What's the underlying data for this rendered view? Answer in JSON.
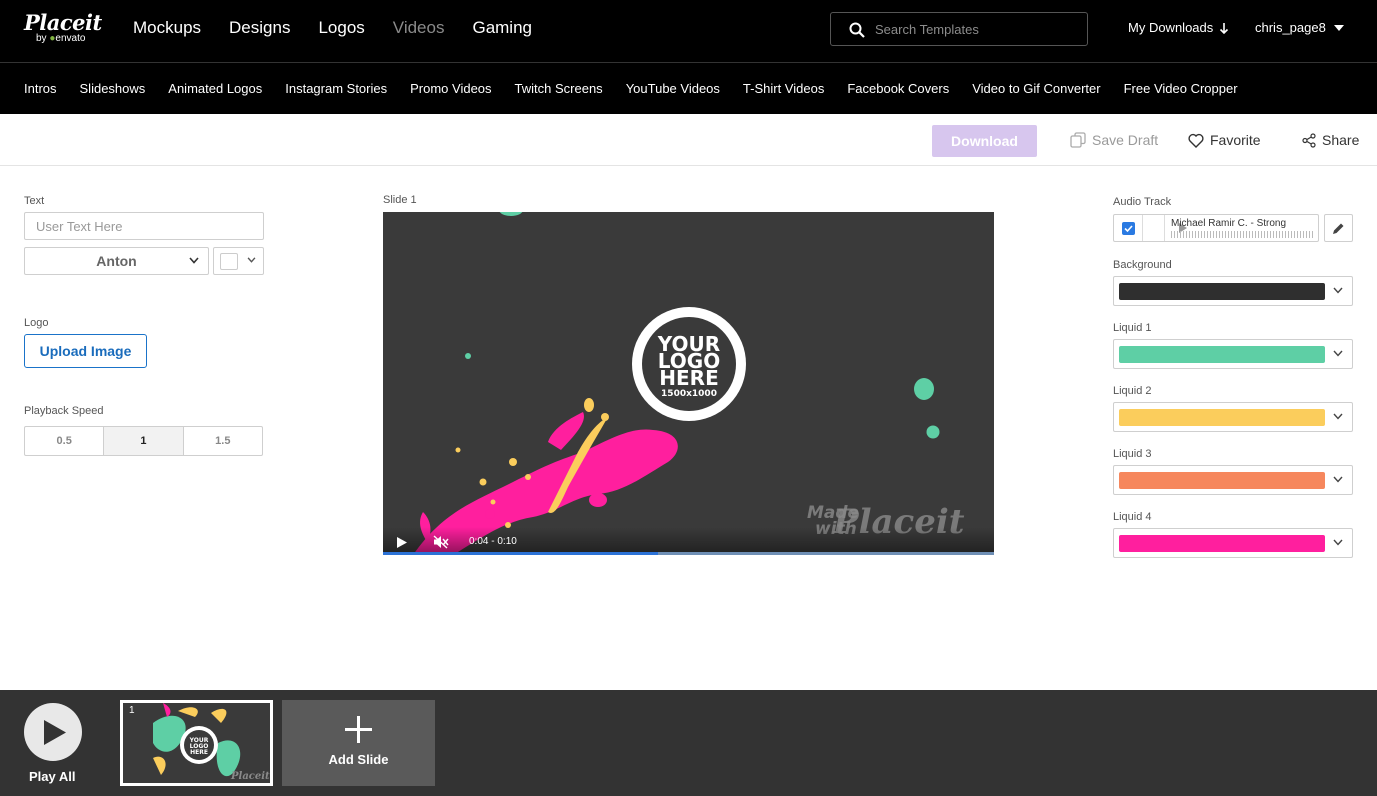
{
  "header": {
    "brand": "Placeit",
    "brand_sub_by": "by",
    "brand_sub_name": "envato",
    "nav": [
      "Mockups",
      "Designs",
      "Logos",
      "Videos",
      "Gaming"
    ],
    "search_placeholder": "Search Templates",
    "downloads_label": "My Downloads",
    "username": "chris_page8"
  },
  "subnav": [
    "Intros",
    "Slideshows",
    "Animated Logos",
    "Instagram Stories",
    "Promo Videos",
    "Twitch Screens",
    "YouTube Videos",
    "T-Shirt Videos",
    "Facebook Covers",
    "Video to Gif Converter",
    "Free Video Cropper"
  ],
  "toolbar": {
    "download": "Download",
    "save_draft": "Save Draft",
    "favorite": "Favorite",
    "share": "Share"
  },
  "left_panel": {
    "text_label": "Text",
    "text_placeholder": "User Text Here",
    "font_value": "Anton",
    "logo_label": "Logo",
    "upload_label": "Upload Image",
    "speed_label": "Playback Speed",
    "speeds": [
      "0.5",
      "1",
      "1.5"
    ],
    "speed_selected": "1"
  },
  "preview": {
    "slide_label": "Slide 1",
    "logo_line1": "YOUR",
    "logo_line2": "LOGO",
    "logo_line3": "HERE",
    "logo_size": "1500x1000",
    "watermark_made": "Made",
    "watermark_with": "with",
    "watermark_brand": "Placeit",
    "time_current": "0:04",
    "time_sep": "-",
    "time_total": "0:10",
    "progress_fraction": 0.45
  },
  "right_panel": {
    "audio_label": "Audio Track",
    "audio_title": "Michael Ramir C. - Strong",
    "background_label": "Background",
    "background_color": "#2f2f2f",
    "liquids": [
      {
        "label": "Liquid 1",
        "color": "#5ecfa5"
      },
      {
        "label": "Liquid 2",
        "color": "#fbcd5c"
      },
      {
        "label": "Liquid 3",
        "color": "#f6875d"
      },
      {
        "label": "Liquid 4",
        "color": "#ff1f9e"
      }
    ]
  },
  "bottom": {
    "play_all": "Play All",
    "slide_number": "1",
    "add_slide": "Add Slide"
  }
}
